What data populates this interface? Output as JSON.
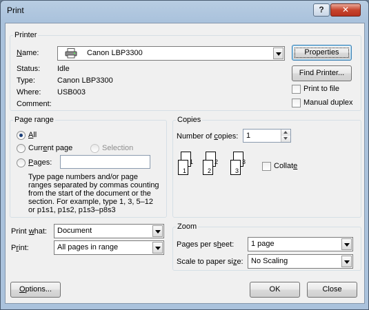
{
  "window": {
    "title": "Print",
    "help_label": "?",
    "close_label": "✕"
  },
  "printer": {
    "group_label": "Printer",
    "name_label": "Name:",
    "name_value": "Canon LBP3300",
    "status_label": "Status:",
    "status_value": "Idle",
    "type_label": "Type:",
    "type_value": "Canon LBP3300",
    "where_label": "Where:",
    "where_value": "USB003",
    "comment_label": "Comment:",
    "comment_value": "",
    "properties_label": "Properties",
    "find_printer_label": "Find Printer...",
    "print_to_file_label": "Print to file",
    "print_to_file_checked": false,
    "manual_duplex_label": "Manual duplex",
    "manual_duplex_checked": false
  },
  "page_range": {
    "group_label": "Page range",
    "all_label": "All",
    "current_page_label": "Current page",
    "selection_label": "Selection",
    "pages_label": "Pages:",
    "pages_value": "",
    "selected": "All",
    "help_text": "Type page numbers and/or page ranges separated by commas counting from the start of the document or the section. For example, type 1, 3, 5–12 or p1s1, p1s2, p1s3–p8s3"
  },
  "copies": {
    "group_label": "Copies",
    "number_label": "Number of copies:",
    "number_value": "1",
    "collate_label": "Collate",
    "collate_checked": false,
    "collate_pages": [
      "1",
      "2",
      "3"
    ]
  },
  "print_what": {
    "label": "Print what:",
    "value": "Document"
  },
  "print": {
    "label": "Print:",
    "value": "All pages in range"
  },
  "zoom": {
    "group_label": "Zoom",
    "pages_per_sheet_label": "Pages per sheet:",
    "pages_per_sheet_value": "1 page",
    "scale_label": "Scale to paper size:",
    "scale_value": "No Scaling"
  },
  "footer": {
    "options_label": "Options...",
    "ok_label": "OK",
    "close_label": "Close"
  },
  "icons": {
    "printer_icon": "printer-icon"
  }
}
